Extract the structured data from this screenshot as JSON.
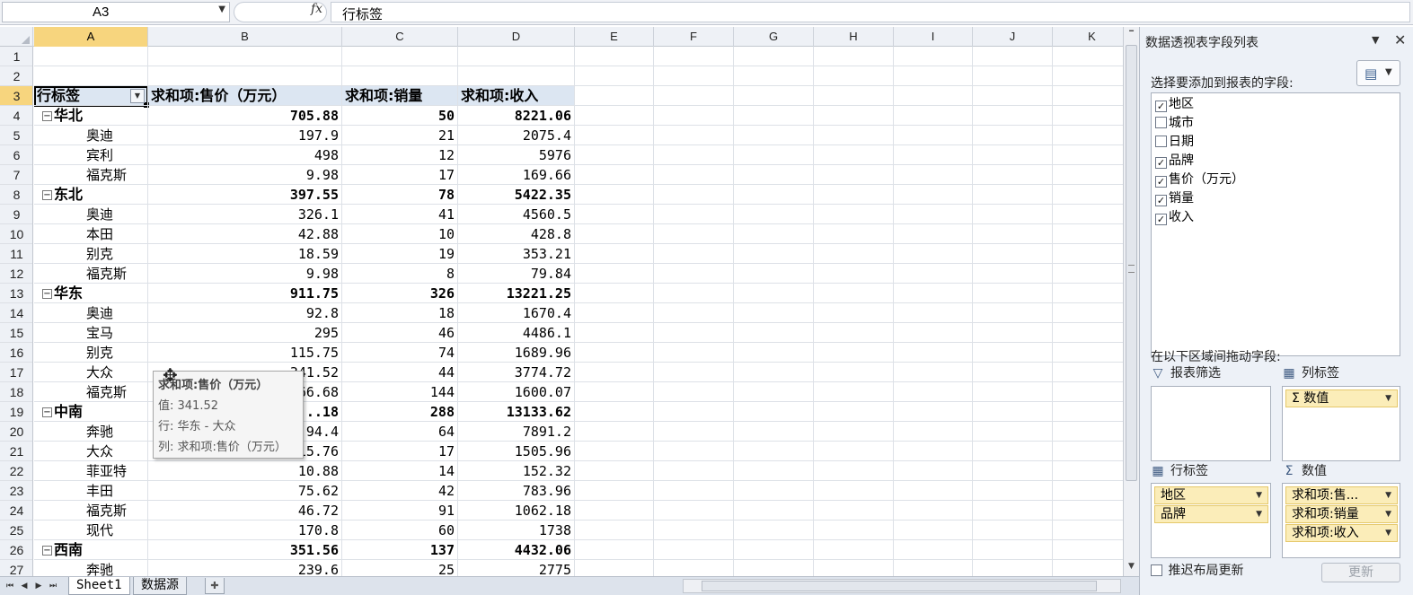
{
  "formula_bar": {
    "name_box": "A3",
    "fx_label": "fx",
    "formula": "行标签"
  },
  "grid": {
    "columns": [
      "A",
      "B",
      "C",
      "D",
      "E",
      "F",
      "G",
      "H",
      "I",
      "J",
      "K"
    ],
    "active_column": "A",
    "row_numbers": [
      "1",
      "2",
      "3",
      "4",
      "5",
      "6",
      "7",
      "8",
      "9",
      "10",
      "11",
      "12",
      "13",
      "14",
      "15",
      "16",
      "17",
      "18",
      "19",
      "20",
      "21",
      "22",
      "23",
      "24",
      "25",
      "26",
      "27"
    ],
    "active_row": "3"
  },
  "pivot": {
    "headers": [
      "行标签",
      "求和项:售价（万元）",
      "求和项:销量",
      "求和项:收入"
    ],
    "rows": [
      {
        "row": "4",
        "type": "group",
        "label": "华北",
        "price": "705.88",
        "qty": "50",
        "income": "8221.06"
      },
      {
        "row": "5",
        "type": "detail",
        "label": "奥迪",
        "price": "197.9",
        "qty": "21",
        "income": "2075.4"
      },
      {
        "row": "6",
        "type": "detail",
        "label": "宾利",
        "price": "498",
        "qty": "12",
        "income": "5976"
      },
      {
        "row": "7",
        "type": "detail",
        "label": "福克斯",
        "price": "9.98",
        "qty": "17",
        "income": "169.66"
      },
      {
        "row": "8",
        "type": "group",
        "label": "东北",
        "price": "397.55",
        "qty": "78",
        "income": "5422.35"
      },
      {
        "row": "9",
        "type": "detail",
        "label": "奥迪",
        "price": "326.1",
        "qty": "41",
        "income": "4560.5"
      },
      {
        "row": "10",
        "type": "detail",
        "label": "本田",
        "price": "42.88",
        "qty": "10",
        "income": "428.8"
      },
      {
        "row": "11",
        "type": "detail",
        "label": "别克",
        "price": "18.59",
        "qty": "19",
        "income": "353.21"
      },
      {
        "row": "12",
        "type": "detail",
        "label": "福克斯",
        "price": "9.98",
        "qty": "8",
        "income": "79.84"
      },
      {
        "row": "13",
        "type": "group",
        "label": "华东",
        "price": "911.75",
        "qty": "326",
        "income": "13221.25"
      },
      {
        "row": "14",
        "type": "detail",
        "label": "奥迪",
        "price": "92.8",
        "qty": "18",
        "income": "1670.4"
      },
      {
        "row": "15",
        "type": "detail",
        "label": "宝马",
        "price": "295",
        "qty": "46",
        "income": "4486.1"
      },
      {
        "row": "16",
        "type": "detail",
        "label": "别克",
        "price": "115.75",
        "qty": "74",
        "income": "1689.96"
      },
      {
        "row": "17",
        "type": "detail",
        "label": "大众",
        "price": "341.52",
        "qty": "44",
        "income": "3774.72"
      },
      {
        "row": "18",
        "type": "detail",
        "label": "福克斯",
        "price": "66.68",
        "qty": "144",
        "income": "1600.07"
      },
      {
        "row": "19",
        "type": "group",
        "label": "中南",
        "price": "..18",
        "qty": "288",
        "income": "13133.62"
      },
      {
        "row": "20",
        "type": "detail",
        "label": "奔驰",
        "price": "94.4",
        "qty": "64",
        "income": "7891.2"
      },
      {
        "row": "21",
        "type": "detail",
        "label": "大众",
        "price": "15.76",
        "qty": "17",
        "income": "1505.96"
      },
      {
        "row": "22",
        "type": "detail",
        "label": "菲亚特",
        "price": "10.88",
        "qty": "14",
        "income": "152.32"
      },
      {
        "row": "23",
        "type": "detail",
        "label": "丰田",
        "price": "75.62",
        "qty": "42",
        "income": "783.96"
      },
      {
        "row": "24",
        "type": "detail",
        "label": "福克斯",
        "price": "46.72",
        "qty": "91",
        "income": "1062.18"
      },
      {
        "row": "25",
        "type": "detail",
        "label": "现代",
        "price": "170.8",
        "qty": "60",
        "income": "1738"
      },
      {
        "row": "26",
        "type": "group",
        "label": "西南",
        "price": "351.56",
        "qty": "137",
        "income": "4432.06"
      },
      {
        "row": "27",
        "type": "detail",
        "label": "奔驰",
        "price": "239.6",
        "qty": "25",
        "income": "2775"
      }
    ],
    "collapse_symbol": "⊟"
  },
  "tooltip": {
    "title": "求和项:售价（万元）",
    "value_line": "值: 341.52",
    "row_line": "行: 华东 - 大众",
    "col_line": "列: 求和项:售价（万元）"
  },
  "sheets": {
    "tabs": [
      "Sheet1",
      "数据源"
    ],
    "active": "Sheet1"
  },
  "field_panel": {
    "title": "数据透视表字段列表",
    "choose_label": "选择要添加到报表的字段:",
    "fields": [
      {
        "label": "地区",
        "checked": true
      },
      {
        "label": "城市",
        "checked": false
      },
      {
        "label": "日期",
        "checked": false
      },
      {
        "label": "品牌",
        "checked": true
      },
      {
        "label": "售价（万元）",
        "checked": true
      },
      {
        "label": "销量",
        "checked": true
      },
      {
        "label": "收入",
        "checked": true
      }
    ],
    "drag_label": "在以下区域间拖动字段:",
    "areas": {
      "filter_label": "报表筛选",
      "column_label": "列标签",
      "row_label": "行标签",
      "values_label": "数值",
      "column_items": [
        "Σ 数值"
      ],
      "row_items": [
        "地区",
        "品牌"
      ],
      "value_items": [
        "求和项:售...",
        "求和项:销量",
        "求和项:收入"
      ]
    },
    "defer_label": "推迟布局更新",
    "update_button": "更新"
  }
}
